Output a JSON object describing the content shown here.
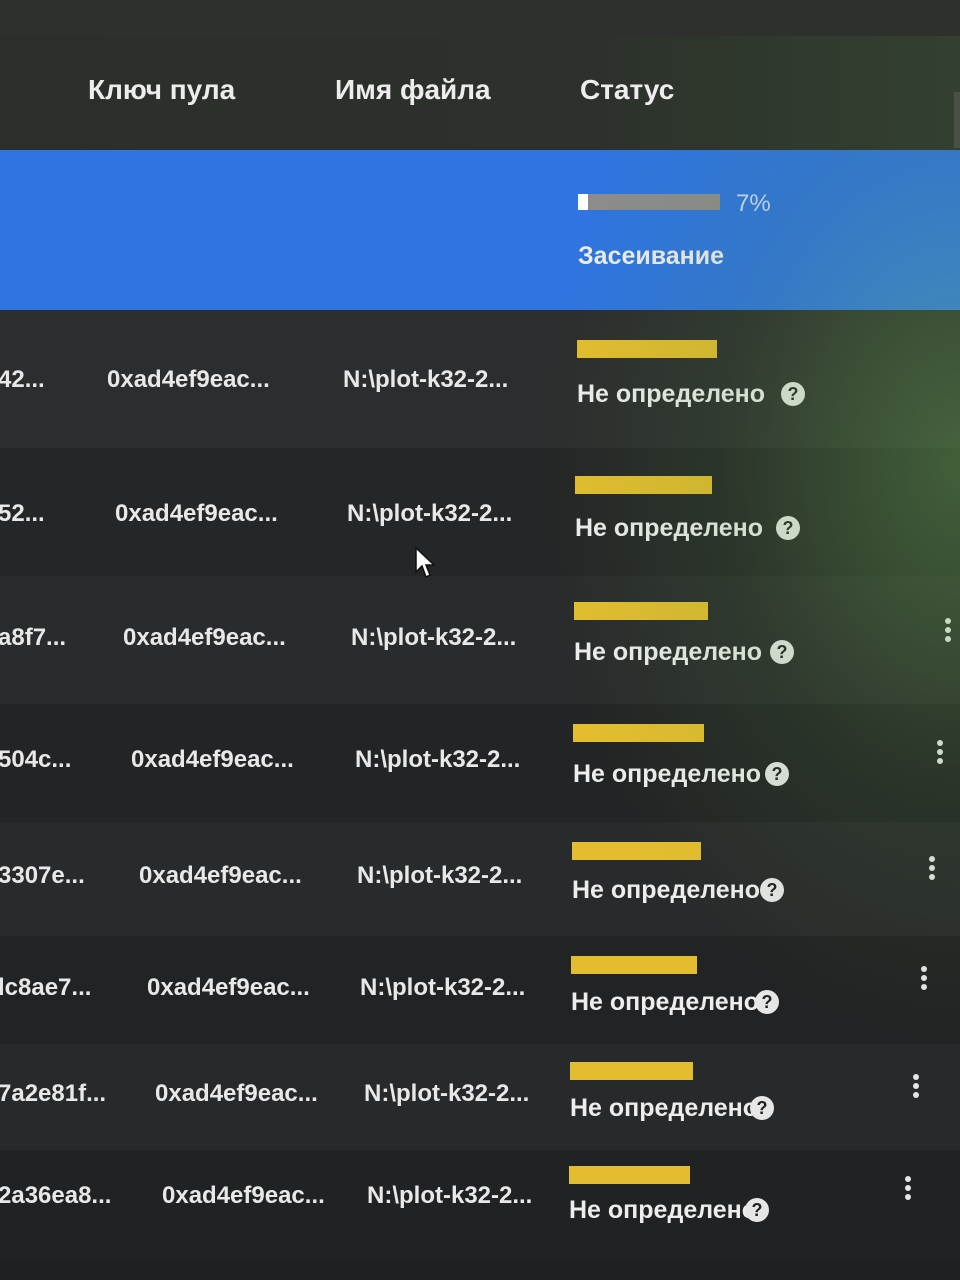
{
  "table": {
    "columns": [
      "Ключ пула",
      "Имя файла",
      "Статус"
    ],
    "selected_row": {
      "progress_percent": 7,
      "progress_label": "7%",
      "status": "Засеивание"
    },
    "rows": [
      {
        "id": "42...",
        "pool_key": "0xad4ef9eac...",
        "file": "N:\\plot-k32-2...",
        "status": "Не определено"
      },
      {
        "id": "52...",
        "pool_key": "0xad4ef9eac...",
        "file": "N:\\plot-k32-2...",
        "status": "Не определено"
      },
      {
        "id": "a8f7...",
        "pool_key": "0xad4ef9eac...",
        "file": "N:\\plot-k32-2...",
        "status": "Не определено"
      },
      {
        "id": "504c...",
        "pool_key": "0xad4ef9eac...",
        "file": "N:\\plot-k32-2...",
        "status": "Не определено"
      },
      {
        "id": "3307e...",
        "pool_key": "0xad4ef9eac...",
        "file": "N:\\plot-k32-2...",
        "status": "Не определено"
      },
      {
        "id": "lc8ae7...",
        "pool_key": "0xad4ef9eac...",
        "file": "N:\\plot-k32-2...",
        "status": "Не определено"
      },
      {
        "id": "7a2e81f...",
        "pool_key": "0xad4ef9eac...",
        "file": "N:\\plot-k32-2...",
        "status": "Не определено"
      },
      {
        "id": "2a36ea8...",
        "pool_key": "0xad4ef9eac...",
        "file": "N:\\plot-k32-2...",
        "status": "Не определено"
      }
    ]
  },
  "icons": {
    "help": "?",
    "more": "kebab-menu-icon",
    "cursor": "mouse-pointer-icon"
  },
  "colors": {
    "selected_row": "#2f74e0",
    "status_bar": "#e3bd2f",
    "progress_fill": "#ffffff"
  }
}
